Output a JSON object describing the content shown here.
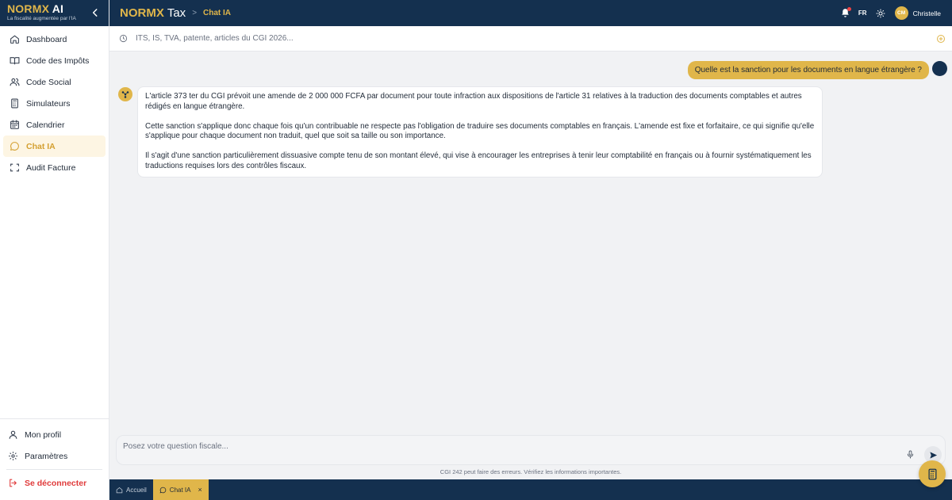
{
  "sidebar": {
    "brand": {
      "name_a": "NORMX",
      "name_b": "AI",
      "tagline": "La fiscalité augmentée par l'IA"
    },
    "items": [
      {
        "label": "Dashboard",
        "icon": "home-icon"
      },
      {
        "label": "Code des Impôts",
        "icon": "book-icon"
      },
      {
        "label": "Code Social",
        "icon": "users-icon"
      },
      {
        "label": "Simulateurs",
        "icon": "calculator-icon"
      },
      {
        "label": "Calendrier",
        "icon": "calendar-icon"
      },
      {
        "label": "Chat IA",
        "icon": "chat-icon",
        "active": true
      },
      {
        "label": "Audit Facture",
        "icon": "scan-icon"
      }
    ],
    "bottom": [
      {
        "label": "Mon profil",
        "icon": "user-icon"
      },
      {
        "label": "Paramètres",
        "icon": "gear-icon"
      },
      {
        "label": "Se déconnecter",
        "icon": "logout-icon"
      }
    ]
  },
  "topbar": {
    "logo_a": "NORMX",
    "logo_b": "Tax",
    "breadcrumb_sep": ">",
    "breadcrumb": "Chat IA",
    "lang": "FR",
    "user_initials": "CM",
    "user_name": "Christelle"
  },
  "search": {
    "text": "ITS, IS, TVA, patente, articles du CGI 2026..."
  },
  "chat": {
    "user_message": "Quelle est la sanction pour les documents en langue étrangère ?",
    "bot_paragraphs": [
      "L'article 373 ter du CGI prévoit une amende de 2 000 000 FCFA par document pour toute infraction aux dispositions de l'article 31 relatives à la traduction des documents comptables et autres rédigés en langue étrangère.",
      "Cette sanction s'applique donc chaque fois qu'un contribuable ne respecte pas l'obligation de traduire ses documents comptables en français. L'amende est fixe et forfaitaire, ce qui signifie qu'elle s'applique pour chaque document non traduit, quel que soit sa taille ou son importance.",
      "Il s'agit d'une sanction particulièrement dissuasive compte tenu de son montant élevé, qui vise à encourager les entreprises à tenir leur comptabilité en français ou à fournir systématiquement les traductions requises lors des contrôles fiscaux."
    ]
  },
  "input": {
    "placeholder": "Posez votre question fiscale...",
    "disclaimer": "CGI 242 peut faire des erreurs. Vérifiez les informations importantes."
  },
  "tabs": [
    {
      "label": "Accueil",
      "icon": "home-icon"
    },
    {
      "label": "Chat IA",
      "icon": "chat-icon",
      "active": true,
      "close": "×"
    }
  ],
  "colors": {
    "navy": "#14304f",
    "gold": "#e0b64a",
    "danger": "#e03b3b"
  }
}
